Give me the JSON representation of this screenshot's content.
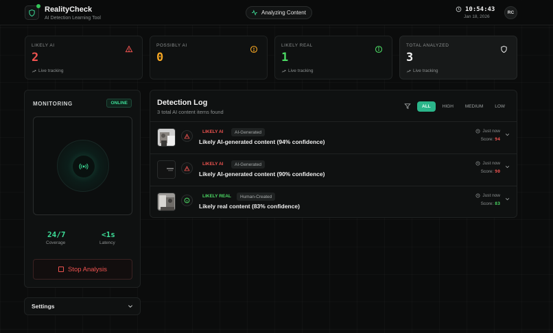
{
  "header": {
    "brand_title": "RealityCheck",
    "brand_subtitle": "AI Detection Learning Tool",
    "status": "Analyzing Content",
    "time": "10:54:43",
    "date": "Jan 18, 2026",
    "avatar_initials": "RC",
    "logo_icon": "shield-icon"
  },
  "stats": [
    {
      "label": "LIKELY AI",
      "value": "2",
      "track": "Live tracking",
      "color": "#ef5350",
      "icon": "warning-triangle-icon"
    },
    {
      "label": "POSSIBLY AI",
      "value": "0",
      "track": "",
      "color": "#f5a623",
      "icon": "alert-circle-icon"
    },
    {
      "label": "LIKELY REAL",
      "value": "1",
      "track": "Live tracking",
      "color": "#4cd964",
      "icon": "info-circle-icon"
    },
    {
      "label": "TOTAL ANALYZED",
      "value": "3",
      "track": "Live tracking",
      "color": "#f1f1f1",
      "icon": "shield-icon"
    }
  ],
  "monitor": {
    "title": "MONITORING",
    "status_badge": "ONLINE",
    "coverage_value": "24/7",
    "coverage_label": "Coverage",
    "latency_value": "<1s",
    "latency_label": "Latency",
    "stop_label": "Stop Analysis"
  },
  "settings": {
    "label": "Settings"
  },
  "log": {
    "title": "Detection Log",
    "subtitle": "3 total AI content items found",
    "filters": [
      "ALL",
      "HIGH",
      "MEDIUM",
      "LOW"
    ],
    "active_filter": "ALL",
    "items": [
      {
        "tag": "LIKELY AI",
        "tag_color": "#ef5350",
        "chip": "AI-Generated",
        "text": "Likely AI-generated content (94% confidence)",
        "time": "Just now",
        "score_label": "Score:",
        "score": "94",
        "icon": "warning-triangle-icon"
      },
      {
        "tag": "LIKELY AI",
        "tag_color": "#ef5350",
        "chip": "AI-Generated",
        "text": "Likely AI-generated content (90% confidence)",
        "time": "Just now",
        "score_label": "Score:",
        "score": "90",
        "icon": "warning-triangle-icon"
      },
      {
        "tag": "LIKELY REAL",
        "tag_color": "#4cd964",
        "chip": "Human-Created",
        "text": "Likely real content (83% confidence)",
        "time": "Just now",
        "score_label": "Score:",
        "score": "83",
        "icon": "info-circle-icon"
      }
    ]
  },
  "colors": {
    "accent": "#2bb58a",
    "online": "#3ddc97",
    "danger": "#ef5350",
    "warn": "#f5a623",
    "real": "#4cd964"
  }
}
